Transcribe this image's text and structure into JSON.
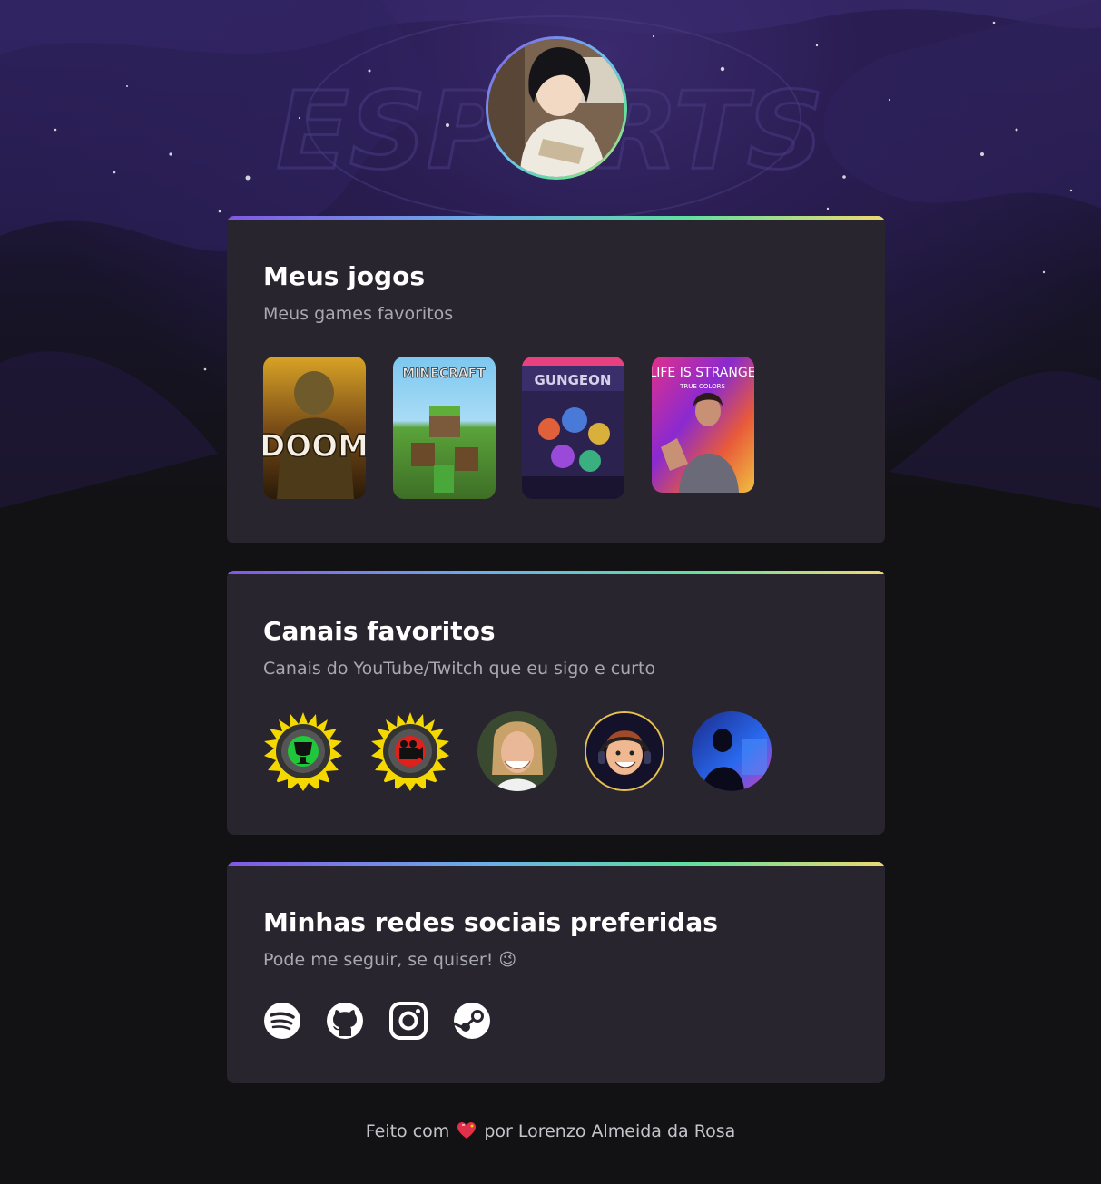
{
  "background": {
    "watermark_text": "ESPORTS"
  },
  "profile": {
    "avatar_alt": "Foto de perfil"
  },
  "games_section": {
    "title": "Meus jogos",
    "subtitle": "Meus games favoritos",
    "games": [
      {
        "name": "DOOM",
        "cover_text": "DOOM"
      },
      {
        "name": "Minecraft",
        "cover_text": "MINECRAFT"
      },
      {
        "name": "Enter the Gungeon",
        "cover_text": "GUNGEON"
      },
      {
        "name": "Life is Strange: True Colors",
        "cover_text": "LIFE IS STRANGE",
        "cover_subtext": "TRUE COLORS"
      }
    ]
  },
  "channels_section": {
    "title": "Canais favoritos",
    "subtitle": "Canais do YouTube/Twitch que eu sigo e curto",
    "channels": [
      {
        "name": "game-theory"
      },
      {
        "name": "film-theory"
      },
      {
        "name": "channel-3"
      },
      {
        "name": "channel-4"
      },
      {
        "name": "channel-5"
      }
    ]
  },
  "social_section": {
    "title": "Minhas redes sociais preferidas",
    "subtitle": "Pode me seguir, se quiser! 😉",
    "networks": [
      {
        "name": "spotify-icon"
      },
      {
        "name": "github-icon"
      },
      {
        "name": "instagram-icon"
      },
      {
        "name": "steam-icon"
      }
    ]
  },
  "footer": {
    "prefix": "Feito com",
    "suffix": "por Lorenzo Almeida da Rosa"
  },
  "colors": {
    "page_bg": "#121214",
    "card_bg": "#29252f",
    "accent_purple": "#8257e5",
    "accent_green": "#5fe0a0",
    "accent_yellow": "#f0d870"
  }
}
